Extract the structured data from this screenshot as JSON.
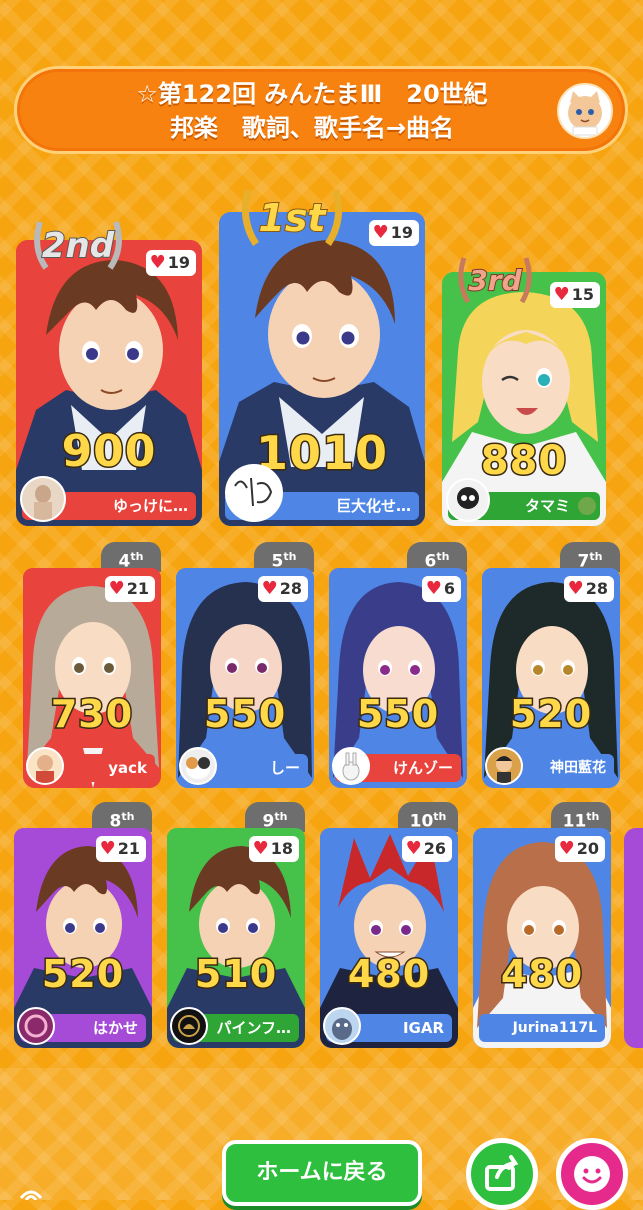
{
  "header": {
    "title_line1": "☆第122回 みんたまⅢ　20世紀",
    "title_line2": "邦楽　歌詞、歌手名→曲名"
  },
  "podium": [
    {
      "rank_label": "2nd",
      "score": "900",
      "likes": "19",
      "player": "ゆっけに…",
      "bg": "#e8433d",
      "bar": "#e8433d"
    },
    {
      "rank_label": "1st",
      "score": "1010",
      "likes": "19",
      "player": "巨大化せ…",
      "bg": "#4f86e6",
      "bar": "#4f86e6"
    },
    {
      "rank_label": "3rd",
      "score": "880",
      "likes": "15",
      "player": "タマミ",
      "bg": "#46c24a",
      "bar": "#2ea535"
    }
  ],
  "ranks": [
    {
      "rank_num": "4",
      "rank_suffix": "th",
      "score": "730",
      "likes": "21",
      "player": "yack",
      "bg": "#e8433d"
    },
    {
      "rank_num": "5",
      "rank_suffix": "th",
      "score": "550",
      "likes": "28",
      "player": "しー",
      "bg": "#4f86e6"
    },
    {
      "rank_num": "6",
      "rank_suffix": "th",
      "score": "550",
      "likes": "6",
      "player": "けんゾー",
      "bg": "#e8433d"
    },
    {
      "rank_num": "7",
      "rank_suffix": "th",
      "score": "520",
      "likes": "28",
      "player": "神田藍花",
      "bg": "#4f86e6"
    },
    {
      "rank_num": "8",
      "rank_suffix": "th",
      "score": "520",
      "likes": "21",
      "player": "はかせ",
      "bg": "#a64ad8"
    },
    {
      "rank_num": "9",
      "rank_suffix": "th",
      "score": "510",
      "likes": "18",
      "player": "パインフ…",
      "bg": "#46c24a"
    },
    {
      "rank_num": "10",
      "rank_suffix": "th",
      "score": "480",
      "likes": "26",
      "player": "IGAR",
      "bg": "#4f86e6"
    },
    {
      "rank_num": "11",
      "rank_suffix": "th",
      "score": "480",
      "likes": "20",
      "player": "Jurina117L",
      "bg": "#4f86e6"
    }
  ],
  "footer": {
    "home_label": "ホームに戻る"
  },
  "icons": {
    "heart": "♥",
    "share": "share-icon",
    "smile": "smile-icon"
  },
  "colors": {
    "background": "#f6a410",
    "title_bar": "#f7820f",
    "home_button": "#2fbf3f",
    "share_button": "#2fbf3f",
    "smile_button": "#e62a8c",
    "gold": "#ffd84a"
  }
}
